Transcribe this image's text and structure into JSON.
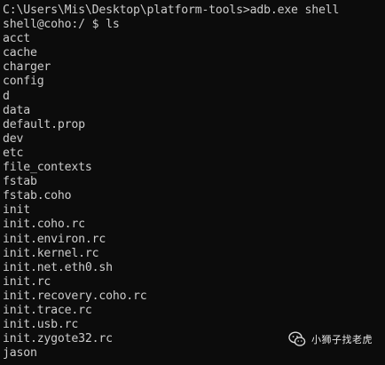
{
  "terminal": {
    "lines": [
      "C:\\Users\\Mis\\Desktop\\platform-tools>adb.exe shell",
      "shell@coho:/ $ ls",
      "acct",
      "cache",
      "charger",
      "config",
      "d",
      "data",
      "default.prop",
      "dev",
      "etc",
      "file_contexts",
      "fstab",
      "fstab.coho",
      "init",
      "init.coho.rc",
      "init.environ.rc",
      "init.kernel.rc",
      "init.net.eth0.sh",
      "init.rc",
      "init.recovery.coho.rc",
      "init.trace.rc",
      "init.usb.rc",
      "init.zygote32.rc",
      "jason"
    ]
  },
  "watermark": {
    "icon": "wechat-icon",
    "text": "小狮子找老虎"
  }
}
